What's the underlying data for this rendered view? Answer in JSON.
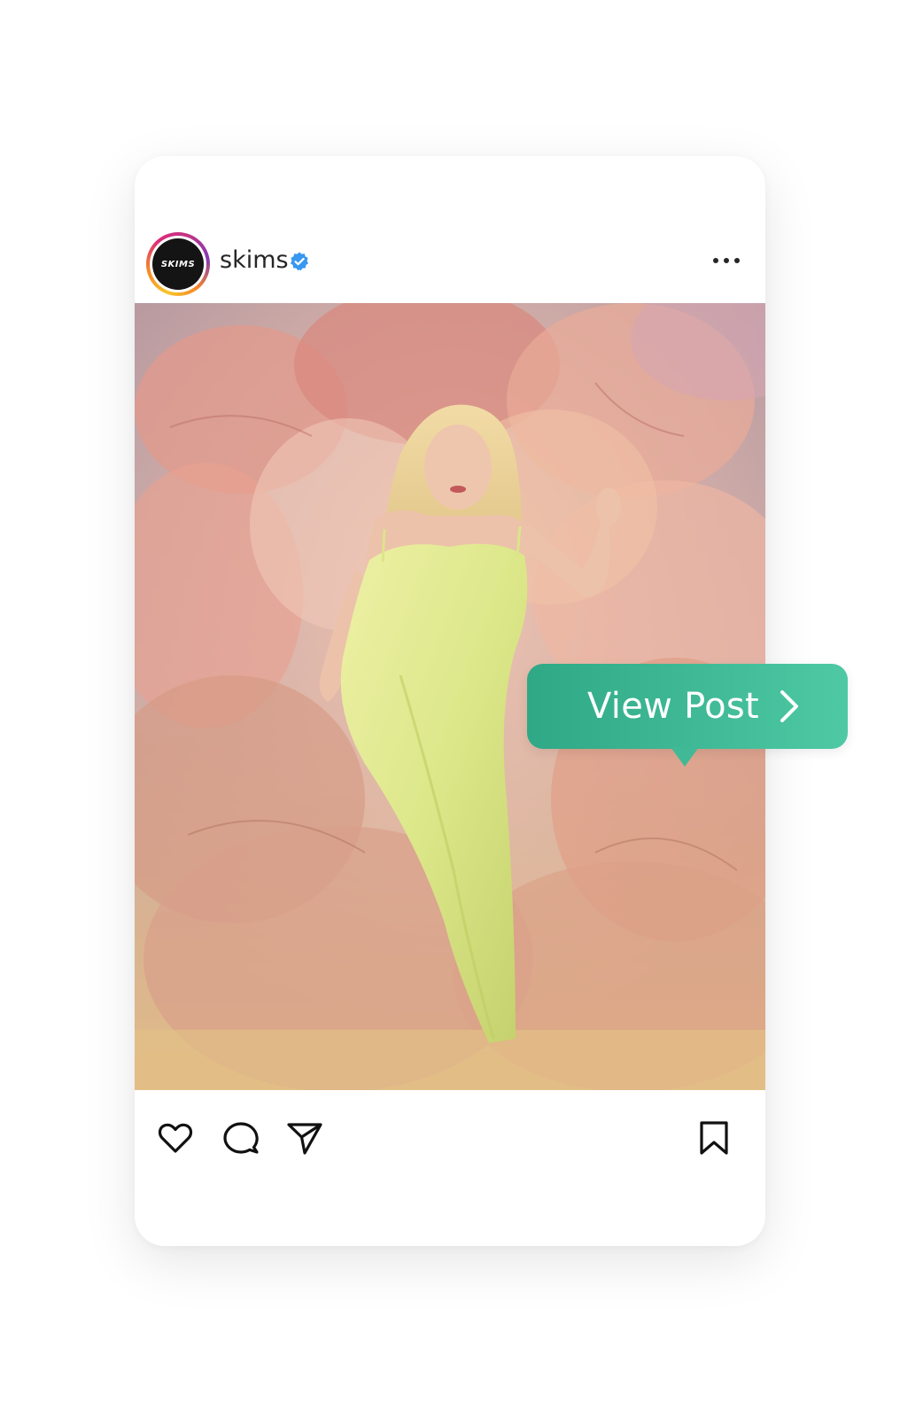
{
  "post": {
    "username": "skims",
    "avatar_text": "SKIMS",
    "verified": true,
    "more_icon": "more-horizontal-icon",
    "photo": "skims-green-slip-dress-photo"
  },
  "actions": {
    "like_icon": "heart-icon",
    "comment_icon": "comment-icon",
    "share_icon": "send-icon",
    "save_icon": "bookmark-icon"
  },
  "cta": {
    "label": "View Post",
    "icon": "chevron-right-icon",
    "color": "#4ec9a4"
  },
  "colors": {
    "verified_badge": "#3897f0",
    "text": "#262626"
  }
}
